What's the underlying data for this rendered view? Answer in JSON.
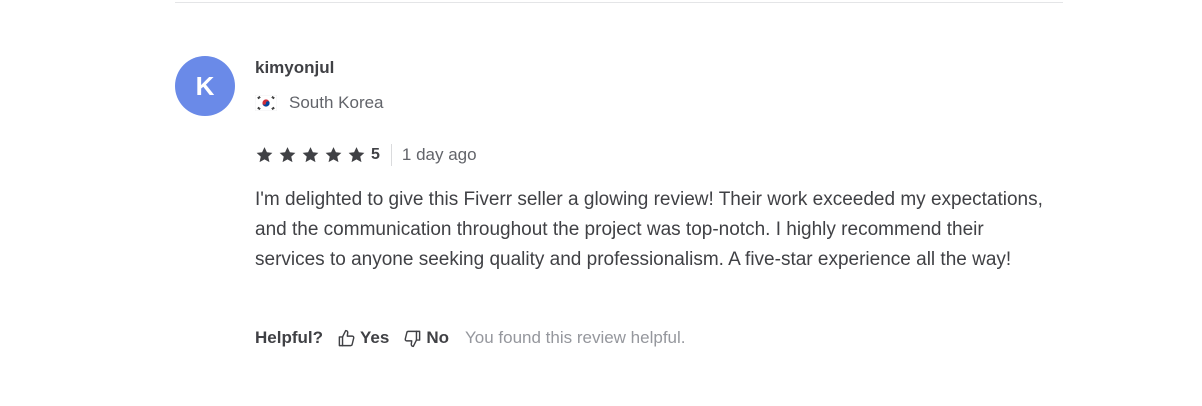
{
  "review": {
    "avatar_letter": "K",
    "avatar_color": "#6a8ae8",
    "username": "kimyonjul",
    "country": "South Korea",
    "flag_icon": "south-korea-flag-icon",
    "rating": 5,
    "rating_label": "5",
    "time_ago": "1 day ago",
    "text": "I'm delighted to give this Fiverr seller a glowing review! Their work exceeded my expectations, and the communication throughout the project was top-notch. I highly recommend their services to anyone seeking quality and professionalism. A five-star experience all the way!"
  },
  "helpful": {
    "label": "Helpful?",
    "yes_label": "Yes",
    "no_label": "No",
    "feedback_message": "You found this review helpful."
  },
  "colors": {
    "text_primary": "#404145",
    "text_secondary": "#62646a",
    "text_muted": "#95979d",
    "star": "#404145",
    "divider": "#e4e5e7"
  }
}
